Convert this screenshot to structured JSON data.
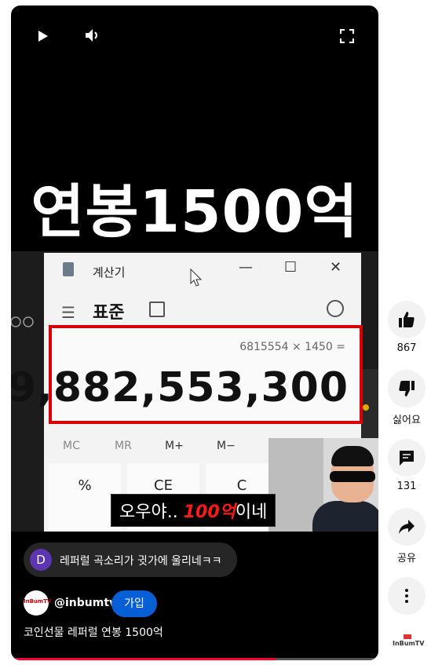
{
  "overlay_title": "연봉1500억",
  "calculator": {
    "window_title": "계산기",
    "mode": "표준",
    "expression": "6815554 × 1450 =",
    "result": "9,882,553,300",
    "memory": [
      "MC",
      "MR",
      "M+",
      "M−"
    ],
    "keys": [
      "%",
      "CE",
      "C"
    ]
  },
  "subtitle": {
    "before": "오우야.. ",
    "highlight": "100억",
    "after": "이네"
  },
  "comment": {
    "avatar_letter": "D",
    "text": "레퍼럴 곡소리가 귓가에 울리네ㅋㅋ"
  },
  "channel": {
    "handle": "@inbumtv",
    "logo_text": "InBumTV",
    "join_label": "가입"
  },
  "video_title": "코인선물 레퍼럴 연봉 1500억",
  "progress_fraction": 0.72,
  "actions": {
    "like_count": "867",
    "dislike_label": "싫어요",
    "comment_count": "131",
    "share_label": "공유"
  },
  "accent": {
    "red": "#d80000",
    "join_blue": "#065fd4",
    "progress": "#ff0033"
  }
}
